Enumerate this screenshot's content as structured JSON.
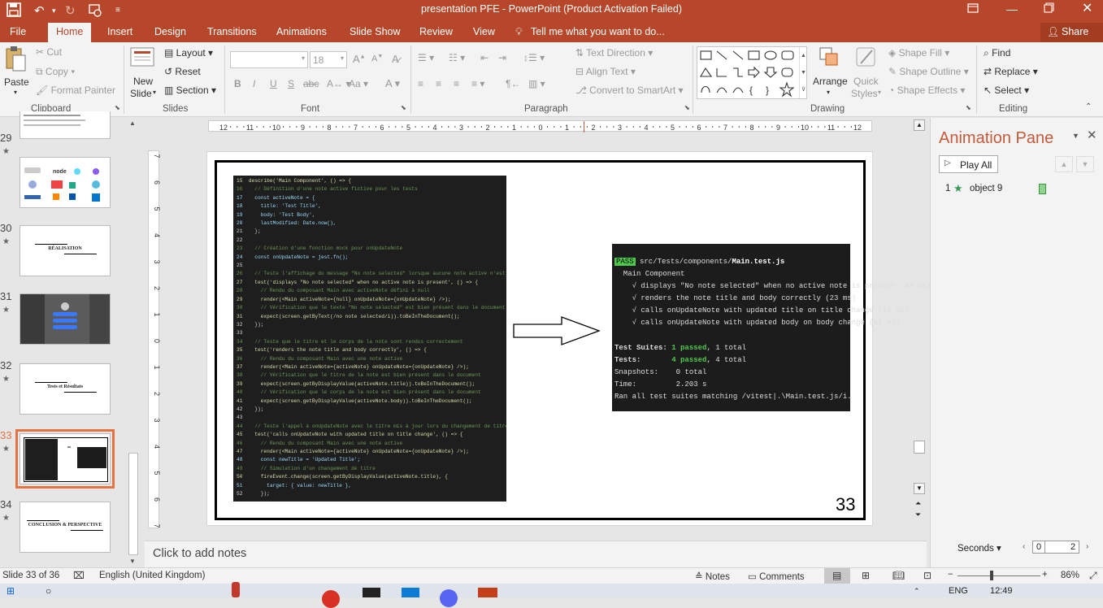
{
  "window": {
    "title": "presentation PFE - PowerPoint (Product Activation Failed)"
  },
  "tabs": [
    "File",
    "Home",
    "Insert",
    "Design",
    "Transitions",
    "Animations",
    "Slide Show",
    "Review",
    "View"
  ],
  "tell_me": "Tell me what you want to do...",
  "share": "Share",
  "ribbon": {
    "clipboard": {
      "paste": "Paste",
      "cut": "Cut",
      "copy": "Copy",
      "format_painter": "Format Painter",
      "label": "Clipboard"
    },
    "slides": {
      "new_slide": "New",
      "new_slide2": "Slide",
      "layout": "Layout",
      "reset": "Reset",
      "section": "Section",
      "label": "Slides"
    },
    "font": {
      "size": "18",
      "label": "Font"
    },
    "paragraph": {
      "text_direction": "Text Direction",
      "align_text": "Align Text",
      "convert_smartart": "Convert to SmartArt",
      "label": "Paragraph"
    },
    "drawing": {
      "arrange": "Arrange",
      "quick": "Quick",
      "styles": "Styles",
      "shape_fill": "Shape Fill",
      "shape_outline": "Shape Outline",
      "shape_effects": "Shape Effects",
      "label": "Drawing"
    },
    "editing": {
      "find": "Find",
      "replace": "Replace",
      "select": "Select",
      "label": "Editing"
    }
  },
  "ruler": [
    "12",
    "11",
    "10",
    "9",
    "8",
    "7",
    "6",
    "5",
    "4",
    "3",
    "2",
    "1",
    "0",
    "1",
    "2",
    "3",
    "4",
    "5",
    "6",
    "7",
    "8",
    "9",
    "10",
    "11",
    "12"
  ],
  "vruler": [
    "7",
    "6",
    "5",
    "4",
    "3",
    "2",
    "1",
    "0",
    "1",
    "2",
    "3",
    "4",
    "5",
    "6",
    "7"
  ],
  "thumbnails": [
    {
      "num": "29",
      "title": ""
    },
    {
      "num": "30",
      "title": "RÉALISATION"
    },
    {
      "num": "31",
      "title": ""
    },
    {
      "num": "32",
      "title": "Tests et Résultats"
    },
    {
      "num": "33",
      "title": ""
    },
    {
      "num": "34",
      "title": "CONCLUSION & PERSPECTIVE"
    }
  ],
  "slide": {
    "number": "33",
    "anim_tag": "1",
    "code": [
      "15  describe('Main Component', () => {",
      "16    // Définition d'une note active fictive pour les tests",
      "17    const activeNote = {",
      "18      title: 'Test Title',",
      "19      body: 'Test Body',",
      "20      lastModified: Date.now(),",
      "21    };",
      "22",
      "23    // Création d'une fonction mock pour onUpdateNote",
      "24    const onUpdateNote = jest.fn();",
      "25",
      "26    // Teste l'affichage du message \"No note selected\" lorsque aucune note active n'est présente",
      "27    test('displays \"No note selected\" when no active note is present', () => {",
      "28      // Rendu du composant Main avec activeNote défini à null",
      "29      render(<Main activeNote={null} onUpdateNote={onUpdateNote} />);",
      "30      // Vérification que le texte \"No note selected\" est bien présent dans le document",
      "31      expect(screen.getByText(/no note selected/i)).toBeInTheDocument();",
      "32    });",
      "33",
      "34    // Teste que le titre et le corps de la note sont rendus correctement",
      "35    test('renders the note title and body correctly', () => {",
      "36      // Rendu du composant Main avec une note active",
      "37      render(<Main activeNote={activeNote} onUpdateNote={onUpdateNote} />);",
      "38      // Vérification que le titre de la note est bien présent dans le document",
      "39      expect(screen.getByDisplayValue(activeNote.title)).toBeInTheDocument();",
      "40      // Vérification que le corps de la note est bien présent dans le document",
      "41      expect(screen.getByDisplayValue(activeNote.body)).toBeInTheDocument();",
      "42    });",
      "43",
      "44    // Teste l'appel à onUpdateNote avec le titre mis à jour lors du changement de titre",
      "45    test('calls onUpdateNote with updated title on title change', () => {",
      "46      // Rendu du composant Main avec une note active",
      "47      render(<Main activeNote={activeNote} onUpdateNote={onUpdateNote} />);",
      "48      const newTitle = 'Updated Title';",
      "49      // Simulation d'un changement de titre",
      "50      fireEvent.change(screen.getByDisplayValue(activeNote.title), {",
      "51        target: { value: newTitle },",
      "52      });"
    ],
    "terminal": {
      "pass": "PASS",
      "file_prefix": " src/Tests/components/",
      "file_name": "Main.test.js",
      "suite": "  Main Component",
      "tests": [
        "    √ displays \"No note selected\" when no active note is present (33 ms)",
        "    √ renders the note title and body correctly (23 ms)",
        "    √ calls onUpdateNote with updated title on title change (16 ms)",
        "    √ calls onUpdateNote with updated body on body change (11 ms)"
      ],
      "suites_label": "Test Suites:",
      "suites_passed": "1 passed",
      "suites_total": ", 1 total",
      "tests_label": "Tests:",
      "tests_passed": "4 passed",
      "tests_total": ", 4 total",
      "snapshots": "Snapshots:    0 total",
      "time": "Time:         2.203 s",
      "ran": "Ran all test suites matching /vitest|.\\Main.test.js/i."
    }
  },
  "notes_placeholder": "Click to add notes",
  "animation_pane": {
    "title": "Animation Pane",
    "play_all": "Play All",
    "item_num": "1",
    "item_label": "object 9",
    "seconds": "Seconds",
    "scale_start": "0",
    "scale_end": "2"
  },
  "status": {
    "slide": "Slide 33 of 36",
    "language": "English (United Kingdom)",
    "notes": "Notes",
    "comments": "Comments",
    "zoom": "86%"
  },
  "taskbar": {
    "lang": "ENG",
    "time": "12:49"
  }
}
